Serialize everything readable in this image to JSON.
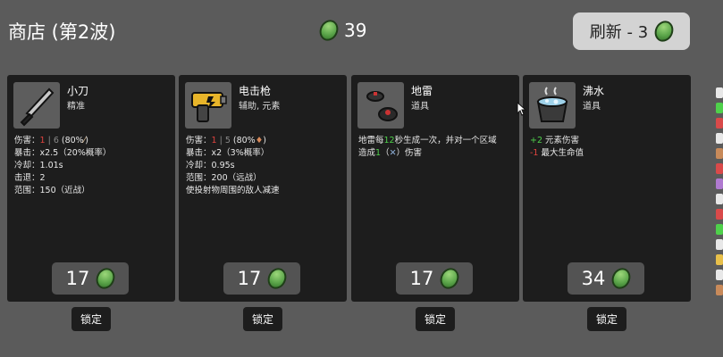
{
  "shop": {
    "title": "商店 (第2波)",
    "materials": "39",
    "reroll_label": "刷新 - 3"
  },
  "cards": [
    {
      "name": "小刀",
      "tag": "精准",
      "icon": "knife-icon",
      "price": "17",
      "lock_label": "锁定"
    },
    {
      "name": "电击枪",
      "tag": "辅助, 元素",
      "icon": "taser-icon",
      "price": "17",
      "lock_label": "锁定"
    },
    {
      "name": "地雷",
      "tag": "道具",
      "icon": "landmine-icon",
      "price": "17",
      "lock_label": "锁定"
    },
    {
      "name": "沸水",
      "tag": "道具",
      "icon": "boiling-water-icon",
      "price": "34",
      "lock_label": "锁定"
    }
  ],
  "knife_stats": {
    "damage_label": "伤害：",
    "damage_a": "1",
    "damage_sep": " | ",
    "damage_b": "6",
    "damage_pct": " (80%",
    "damage_close": ")",
    "crit": "暴击：x2.5（20%概率）",
    "cooldown": "冷却：1.01s",
    "knockback": "击退：2",
    "range": "范围：150（近战）"
  },
  "taser_stats": {
    "damage_label": "伤害：",
    "damage_a": "1",
    "damage_sep": " | ",
    "damage_b": "5",
    "damage_pct": " (80%",
    "damage_close": ")",
    "crit": "暴击：x2（3%概率）",
    "cooldown": "冷却：0.95s",
    "range": "范围：200（远战）",
    "effect": "使投射物周围的敌人减速"
  },
  "landmine_stats": {
    "line1_a": "地雷每",
    "line1_num": "12",
    "line1_b": "秒生成一次，并对一个区域",
    "line2_a": "造成",
    "line2_num": "1",
    "line2_b": "（",
    "line2_sym": "✕",
    "line2_c": "）伤害"
  },
  "boiling_stats": {
    "plus": "+2",
    "plus_label": " 元素伤害",
    "minus": "-1",
    "minus_label": " 最大生命值"
  },
  "colors": {
    "background": "#5b5b5b",
    "card": "#1d1d1d",
    "positive": "#4fd14b",
    "negative": "#e0433e",
    "gem": "#5ba54a"
  }
}
